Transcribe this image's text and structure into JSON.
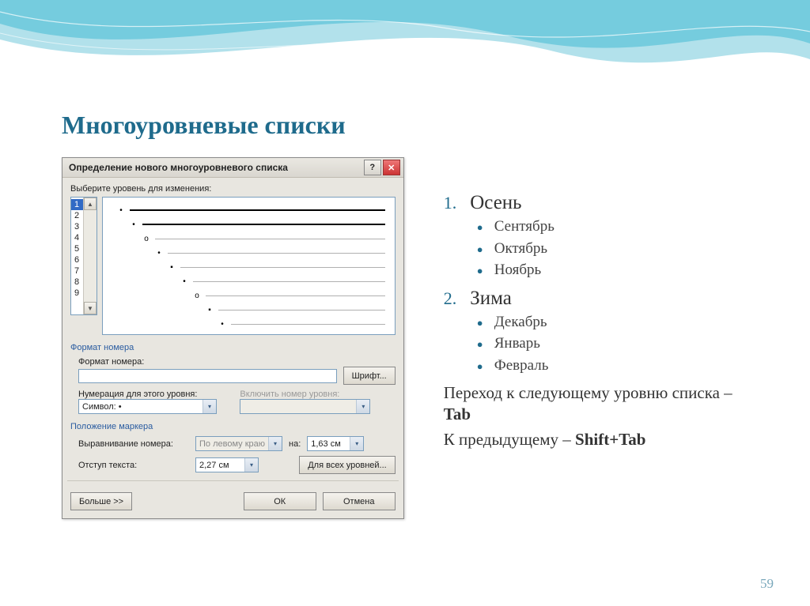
{
  "slide": {
    "title": "Многоуровневые списки",
    "pageNumber": "59"
  },
  "dialog": {
    "title": "Определение нового многоуровневого списка",
    "selectLevelLabel": "Выберите уровень для изменения:",
    "levels": [
      "1",
      "2",
      "3",
      "4",
      "5",
      "6",
      "7",
      "8",
      "9"
    ],
    "selectedLevel": "1",
    "format": {
      "title": "Формат номера",
      "numberFormatLabel": "Формат номера:",
      "numberFormatValue": "",
      "fontBtn": "Шрифт...",
      "numberingLabel": "Нумерация для этого уровня:",
      "numberingValue": "Символ: •",
      "includeLabel": "Включить номер уровня:",
      "includeValue": ""
    },
    "marker": {
      "title": "Положение маркера",
      "alignLabel": "Выравнивание номера:",
      "alignValue": "По левому краю",
      "atLabel": "на:",
      "atValue": "1,63 см",
      "textIndentLabel": "Отступ текста:",
      "textIndentValue": "2,27 см",
      "allLevelsBtn": "Для всех уровней..."
    },
    "footer": {
      "moreBtn": "Больше >>",
      "okBtn": "ОК",
      "cancelBtn": "Отмена"
    }
  },
  "right": {
    "items": [
      {
        "num": "1.",
        "text": "Осень",
        "children": [
          "Сентябрь",
          "Октябрь",
          "Ноябрь"
        ]
      },
      {
        "num": "2.",
        "text": "Зима",
        "children": [
          "Декабрь",
          "Январь",
          "Февраль"
        ]
      }
    ],
    "hint1a": "Переход к следующему уровню списка – ",
    "hint1b": "Tab",
    "hint2a": "К предыдущему – ",
    "hint2b": "Shift+Tab"
  }
}
